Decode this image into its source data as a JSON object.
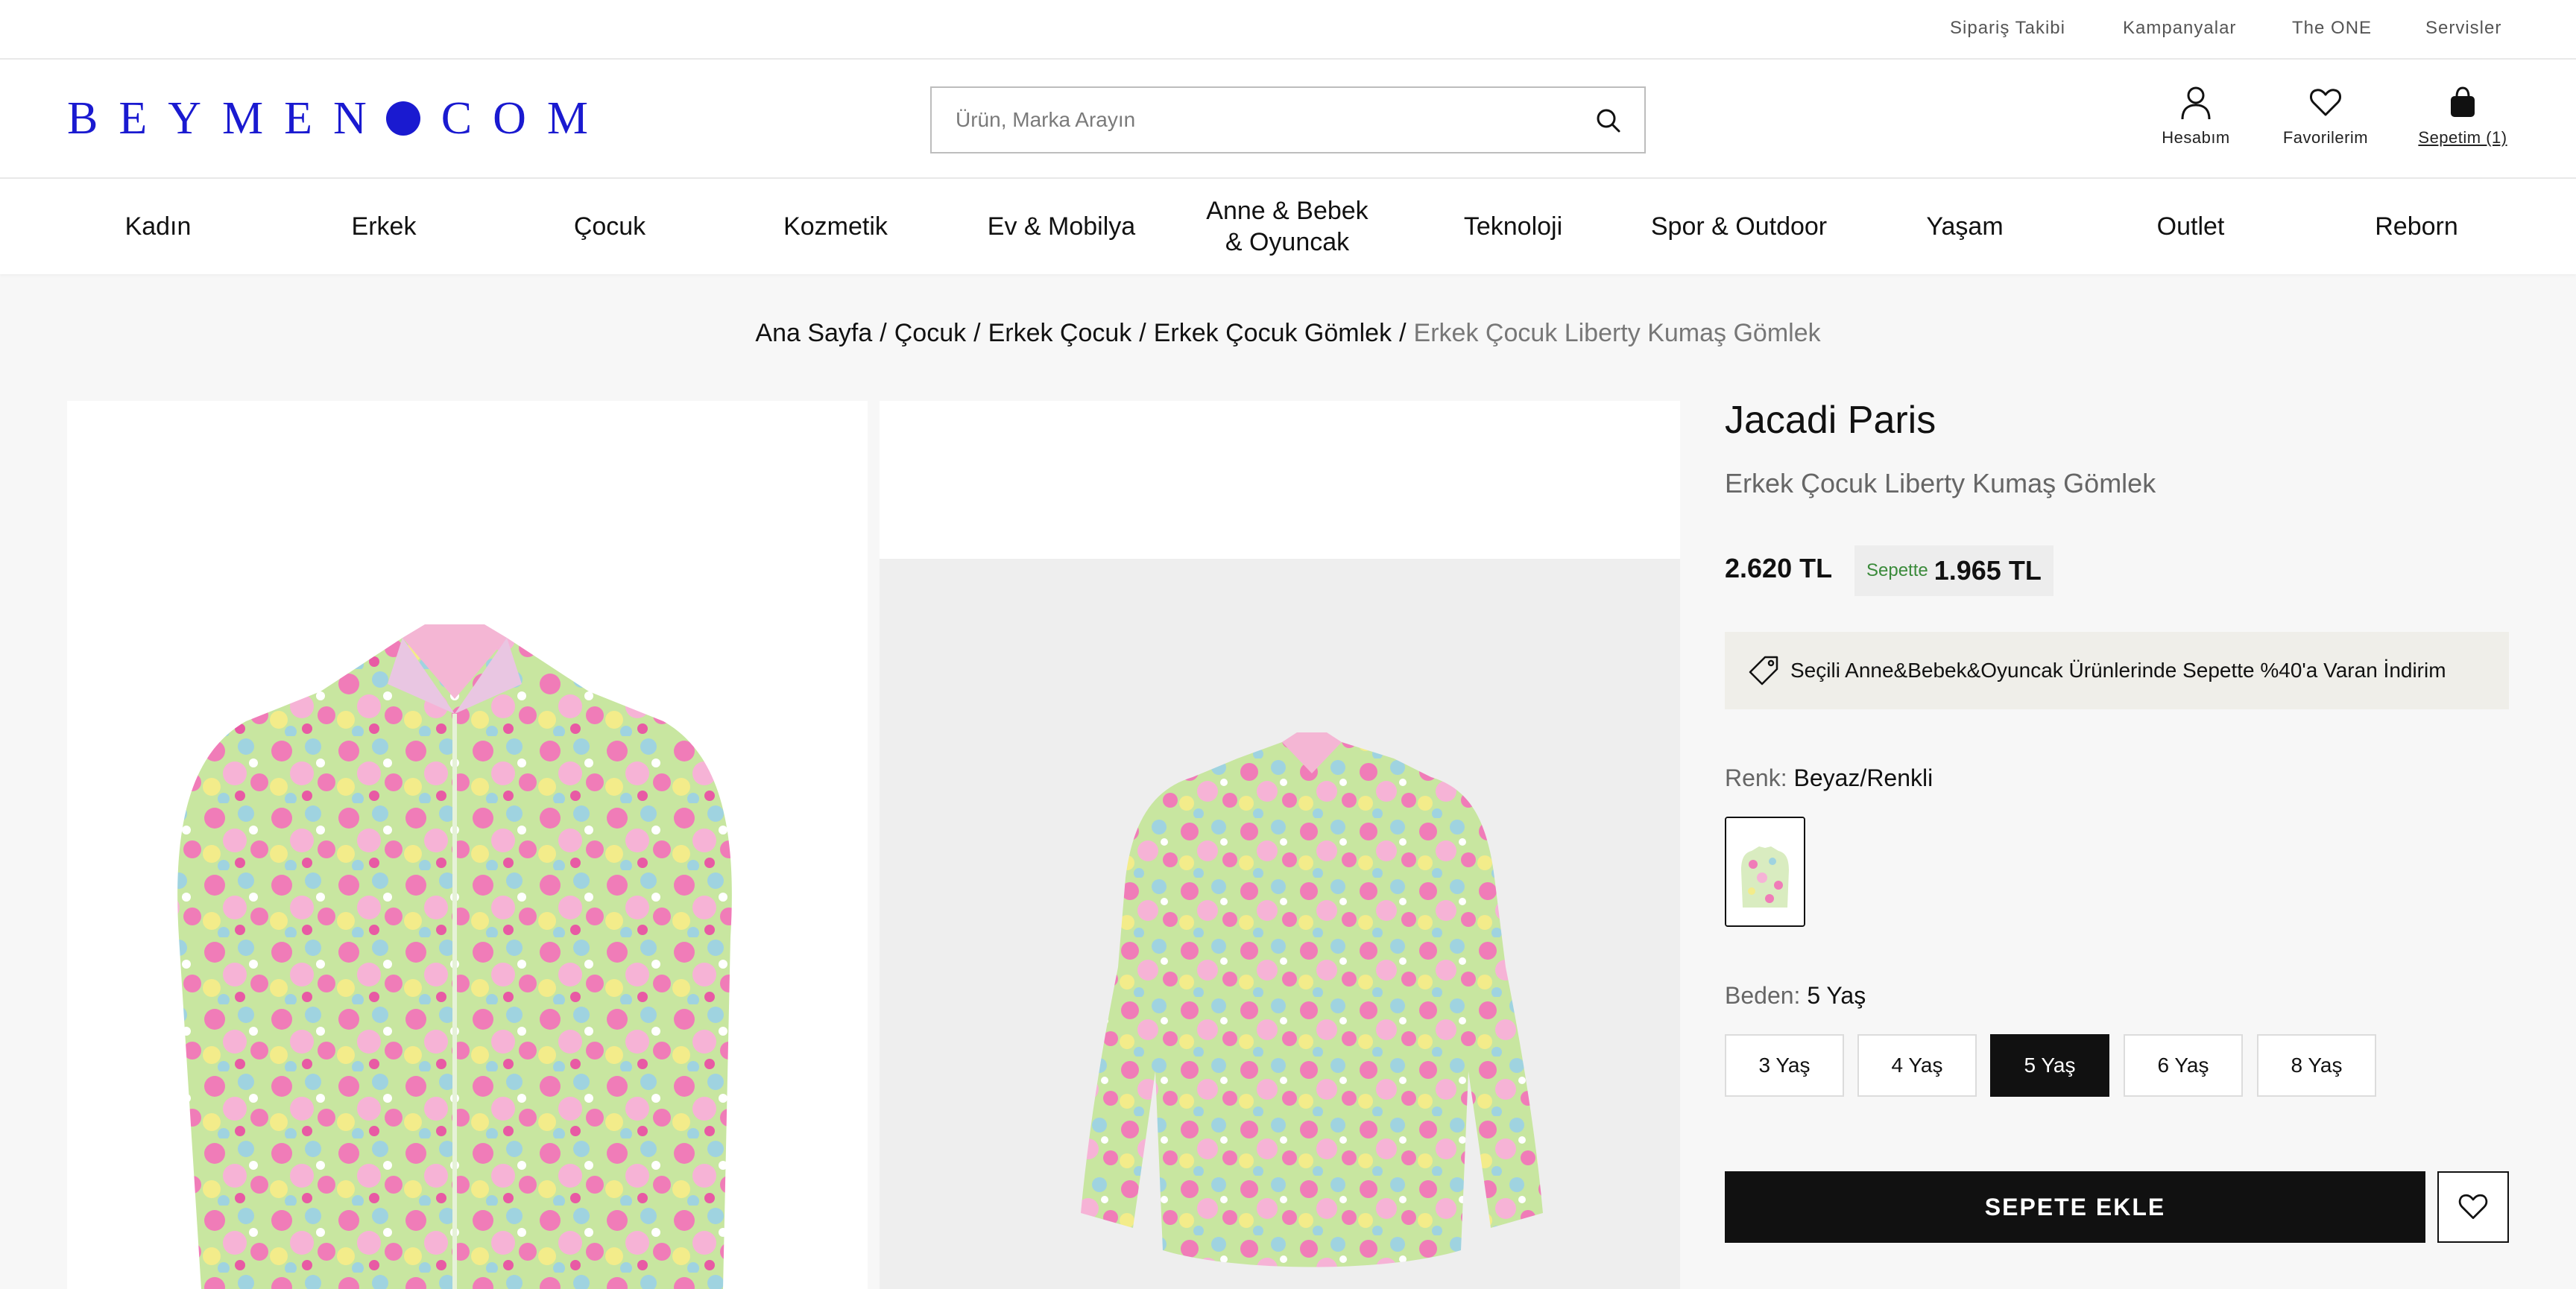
{
  "topbar": {
    "links": [
      "Sipariş Takibi",
      "Kampanyalar",
      "The ONE",
      "Servisler"
    ]
  },
  "header": {
    "logo_left": "BEYMEN",
    "logo_right": "COM",
    "search_placeholder": "Ürün, Marka Arayın",
    "account_label": "Hesabım",
    "favorites_label": "Favorilerim",
    "cart_label": "Sepetim (1)",
    "brand_color": "#1a1ad0"
  },
  "nav": {
    "items": [
      "Kadın",
      "Erkek",
      "Çocuk",
      "Kozmetik",
      "Ev & Mobilya",
      "Anne & Bebek & Oyuncak",
      "Teknoloji",
      "Spor & Outdoor",
      "Yaşam",
      "Outlet",
      "Reborn"
    ]
  },
  "breadcrumb": {
    "items": [
      "Ana Sayfa",
      "Çocuk",
      "Erkek Çocuk",
      "Erkek Çocuk Gömlek"
    ],
    "current": "Erkek Çocuk Liberty Kumaş Gömlek",
    "separator": "/"
  },
  "product": {
    "brand": "Jacadi Paris",
    "name": "Erkek Çocuk Liberty Kumaş Gömlek",
    "price": "2.620 TL",
    "basket_label": "Sepette",
    "basket_price": "1.965 TL",
    "promo_text": "Seçili Anne&Bebek&Oyuncak Ürünlerinde Sepette %40'a Varan İndirim",
    "color_label": "Renk:",
    "color_value": "Beyaz/Renkli",
    "size_label": "Beden:",
    "size_value": "5 Yaş",
    "sizes": [
      "3 Yaş",
      "4 Yaş",
      "5 Yaş",
      "6 Yaş",
      "8 Yaş"
    ],
    "selected_size_index": 2,
    "add_to_cart": "SEPETE EKLE"
  },
  "icons": {
    "search": "search-icon",
    "account": "user-icon",
    "favorites": "heart-icon",
    "cart": "shopping-bag-icon",
    "promo": "tag-icon",
    "wishlist": "heart-icon"
  }
}
